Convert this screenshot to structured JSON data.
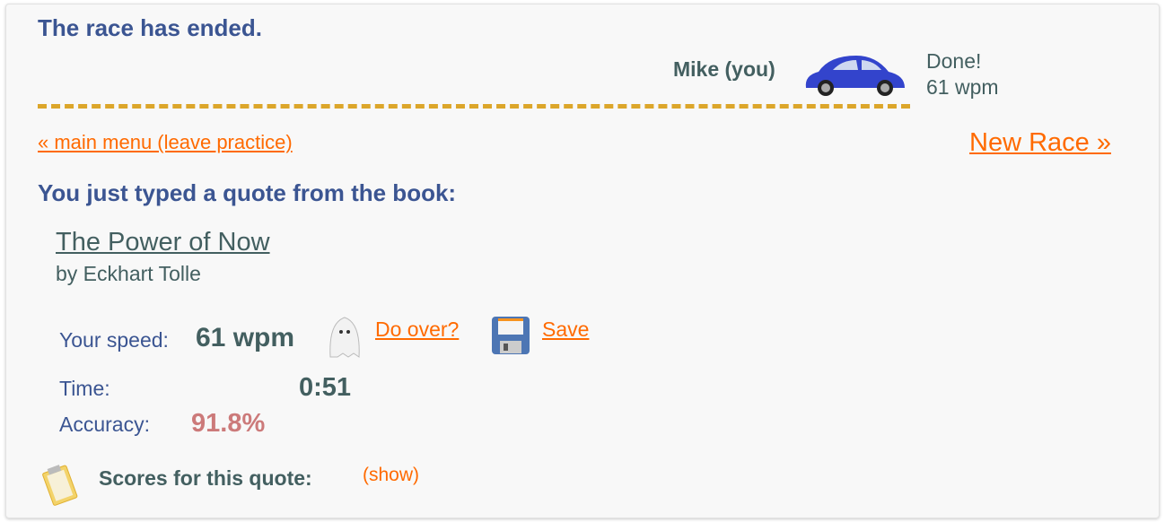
{
  "status": {
    "title": "The race has ended."
  },
  "racer": {
    "name": "Mike (you)",
    "state": "Done!",
    "wpm": "61 wpm"
  },
  "nav": {
    "main_menu": "« main menu (leave practice)",
    "new_race": "New Race »"
  },
  "quote": {
    "heading": "You just typed a quote from the book:",
    "book_title": "The Power of Now",
    "author": "by Eckhart Tolle"
  },
  "results": {
    "speed_label": "Your speed:",
    "speed_value": "61 wpm",
    "do_over": "Do over?",
    "save": "Save",
    "time_label": "Time:",
    "time_value": "0:51",
    "accuracy_label": "Accuracy:",
    "accuracy_value": "91.8%"
  },
  "scores": {
    "label": "Scores for this quote:",
    "show": "(show)"
  },
  "colors": {
    "heading": "#3b5592",
    "link": "#ff6a00",
    "accuracy": "#cc7a7a",
    "track": "#dca62a"
  }
}
